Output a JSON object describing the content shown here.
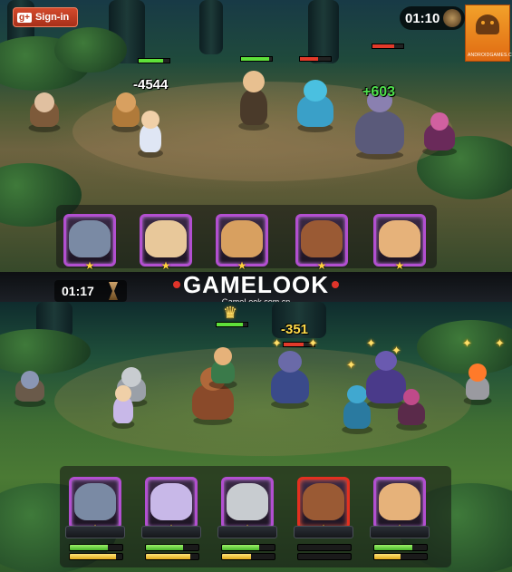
{
  "top_panel": {
    "signin": {
      "icon": "g+",
      "label": "Sign-in"
    },
    "timer": "01:10",
    "app_badge": {
      "caption": "ANDROIDGAMES.COM"
    },
    "damage_numbers": [
      {
        "text": "-4544",
        "kind": "damage"
      },
      {
        "text": "+603",
        "kind": "heal"
      }
    ],
    "hero_portraits": [
      {
        "name": "dwarf-gunner",
        "frame": "purple",
        "face_color": "#7a8aa4"
      },
      {
        "name": "ice-mage",
        "frame": "purple",
        "face_color": "#e8c89a"
      },
      {
        "name": "viking-warrior",
        "frame": "purple",
        "face_color": "#d8a060"
      },
      {
        "name": "minotaur-brute",
        "frame": "purple",
        "face_color": "#9a5a34"
      },
      {
        "name": "witch-ranger",
        "frame": "purple",
        "face_color": "#e6b27a"
      }
    ]
  },
  "brand": {
    "logo_text": "GAMELOOK",
    "url": "GameLook.com.cn"
  },
  "bottom_panel": {
    "timer": "01:17",
    "damage_numbers": [
      {
        "text": "-351",
        "kind": "damage"
      }
    ],
    "hero_portraits": [
      {
        "name": "dwarf-gunner",
        "frame": "purple",
        "hp": 0.72,
        "energy": 0.88,
        "face_color": "#7a8aa4"
      },
      {
        "name": "ice-mage",
        "frame": "purple",
        "hp": 0.7,
        "energy": 0.85,
        "face_color": "#c8b8e8"
      },
      {
        "name": "viking-warrior",
        "frame": "purple",
        "hp": 0.7,
        "energy": 0.55,
        "face_color": "#c8ccd0"
      },
      {
        "name": "minotaur-brute",
        "frame": "red",
        "hp": 0.0,
        "energy": 0.0,
        "face_color": "#9a5a34"
      },
      {
        "name": "pirate-captain",
        "frame": "purple",
        "hp": 0.72,
        "energy": 0.5,
        "face_color": "#e6b27a"
      }
    ]
  },
  "colors": {
    "portrait_frame": "#b24fd0",
    "portrait_frame_active": "#e23020",
    "hp_bar": "#5ee03a",
    "energy_bar": "#e2aa1a",
    "signin_red": "#c0391b"
  }
}
